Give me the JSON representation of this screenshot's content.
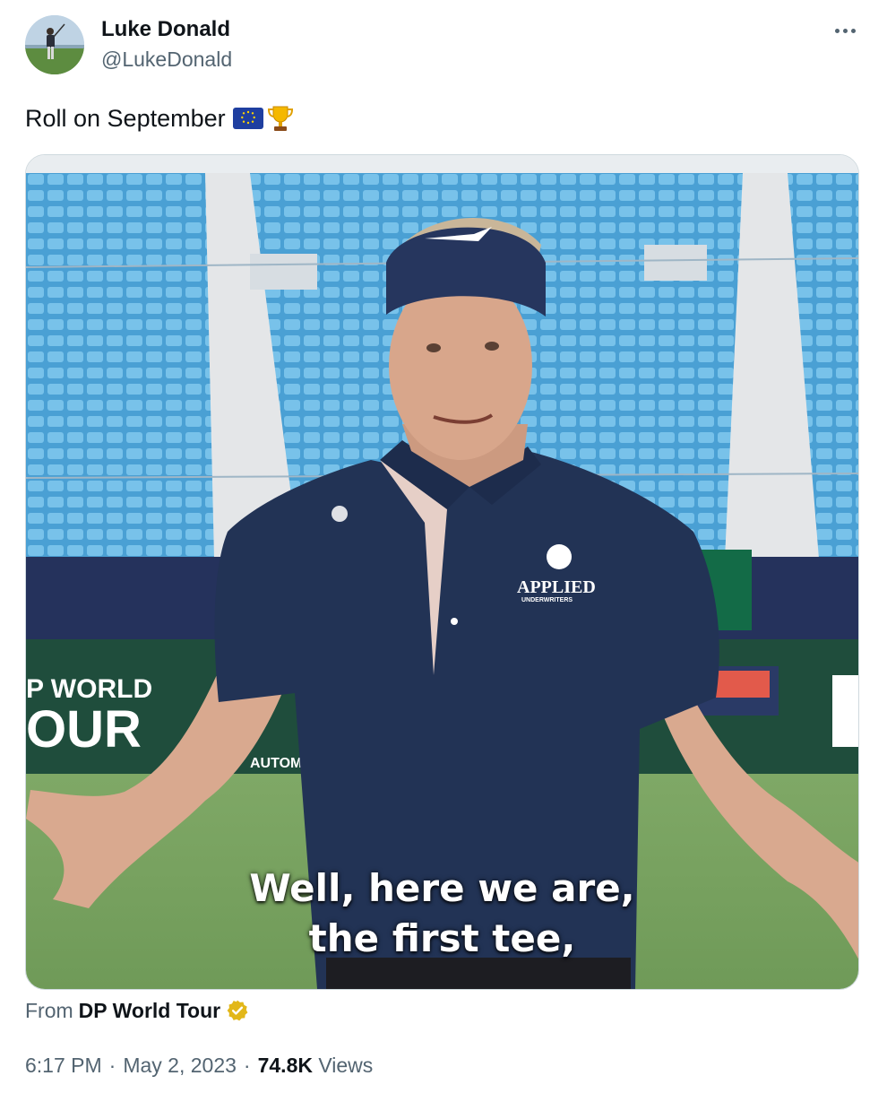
{
  "author": {
    "display_name": "Luke Donald",
    "handle": "@LukeDonald"
  },
  "tweet": {
    "text": "Roll on September",
    "emojis": [
      "eu-flag-icon",
      "trophy-icon"
    ]
  },
  "media": {
    "caption_line1": "Well, here we are,",
    "caption_line2": "the first tee,",
    "scene_texts": {
      "shirt_logo": "APPLIED",
      "shirt_logo_sub": "UNDERWRITERS",
      "board_line1": "P WORLD",
      "board_line2": "OUR",
      "board_small": "AUTOM"
    }
  },
  "source": {
    "prefix": "From",
    "name": "DP World Tour"
  },
  "meta": {
    "time": "6:17 PM",
    "separator": "·",
    "date": "May 2, 2023",
    "views_count": "74.8K",
    "views_label": "Views"
  },
  "colors": {
    "text_primary": "#0f1419",
    "text_secondary": "#536471",
    "border": "#cfd9de",
    "verified_gold": "#e2b719",
    "shirt_navy": "#223355",
    "seat_blue": "#5fb0e0"
  }
}
